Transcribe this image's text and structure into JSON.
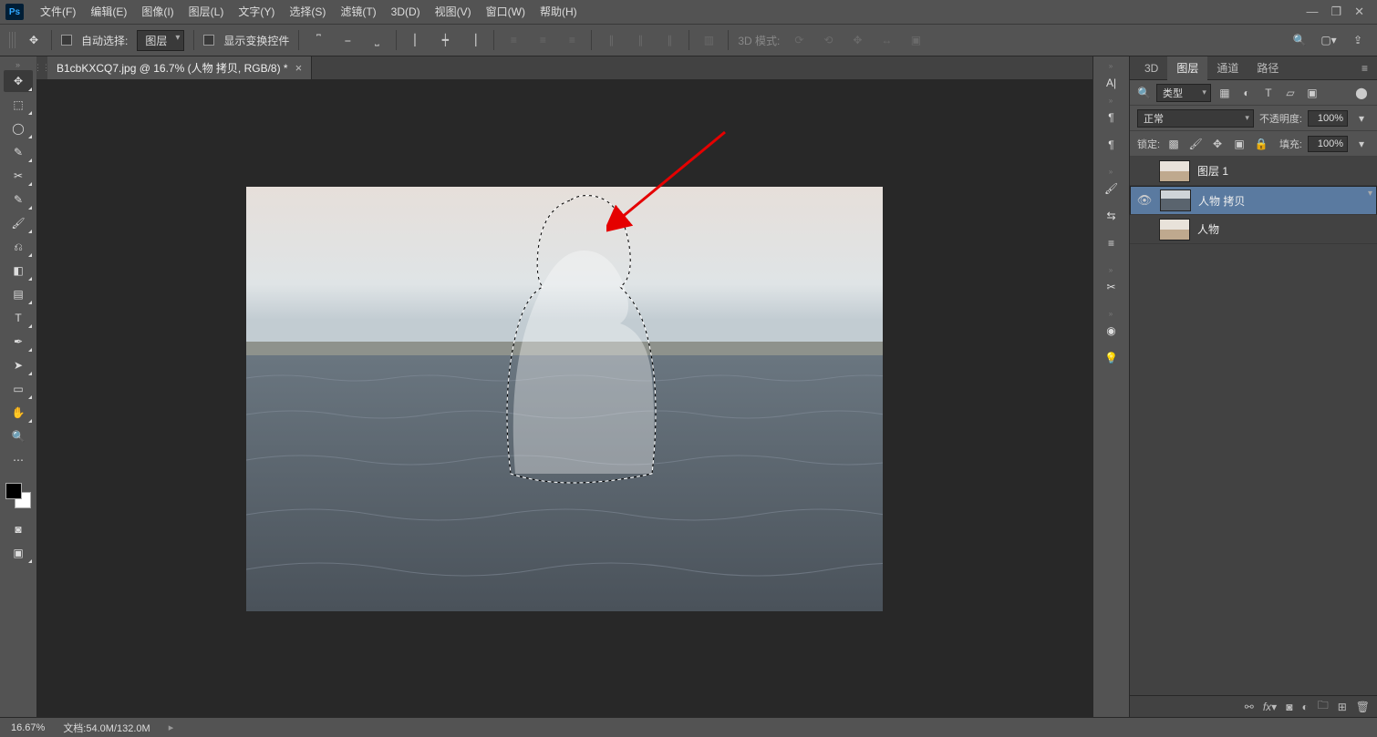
{
  "menu": {
    "items": [
      "文件(F)",
      "编辑(E)",
      "图像(I)",
      "图层(L)",
      "文字(Y)",
      "选择(S)",
      "滤镜(T)",
      "3D(D)",
      "视图(V)",
      "窗口(W)",
      "帮助(H)"
    ]
  },
  "window_controls": {
    "min": "—",
    "max": "❐",
    "close": "✕"
  },
  "options": {
    "auto_select_label": "自动选择:",
    "auto_select_value": "图层",
    "show_transform_label": "显示变换控件",
    "mode3d_label": "3D 模式:"
  },
  "document": {
    "tab_title": "B1cbKXCQ7.jpg @ 16.7% (人物 拷贝, RGB/8) *"
  },
  "panels": {
    "tabs": {
      "d3": "3D",
      "layers": "图层",
      "channels": "通道",
      "paths": "路径"
    },
    "filter_label": "类型",
    "blend_mode": "正常",
    "opacity_label": "不透明度:",
    "opacity_value": "100%",
    "lock_label": "锁定:",
    "fill_label": "填充:",
    "fill_value": "100%",
    "layers": [
      {
        "visible": false,
        "name": "图层 1",
        "thumb": "person"
      },
      {
        "visible": true,
        "name": "人物 拷贝",
        "thumb": "sea",
        "selected": true
      },
      {
        "visible": false,
        "name": "人物",
        "thumb": "person"
      }
    ]
  },
  "status": {
    "zoom": "16.67%",
    "doc_info": "文档:54.0M/132.0M"
  }
}
